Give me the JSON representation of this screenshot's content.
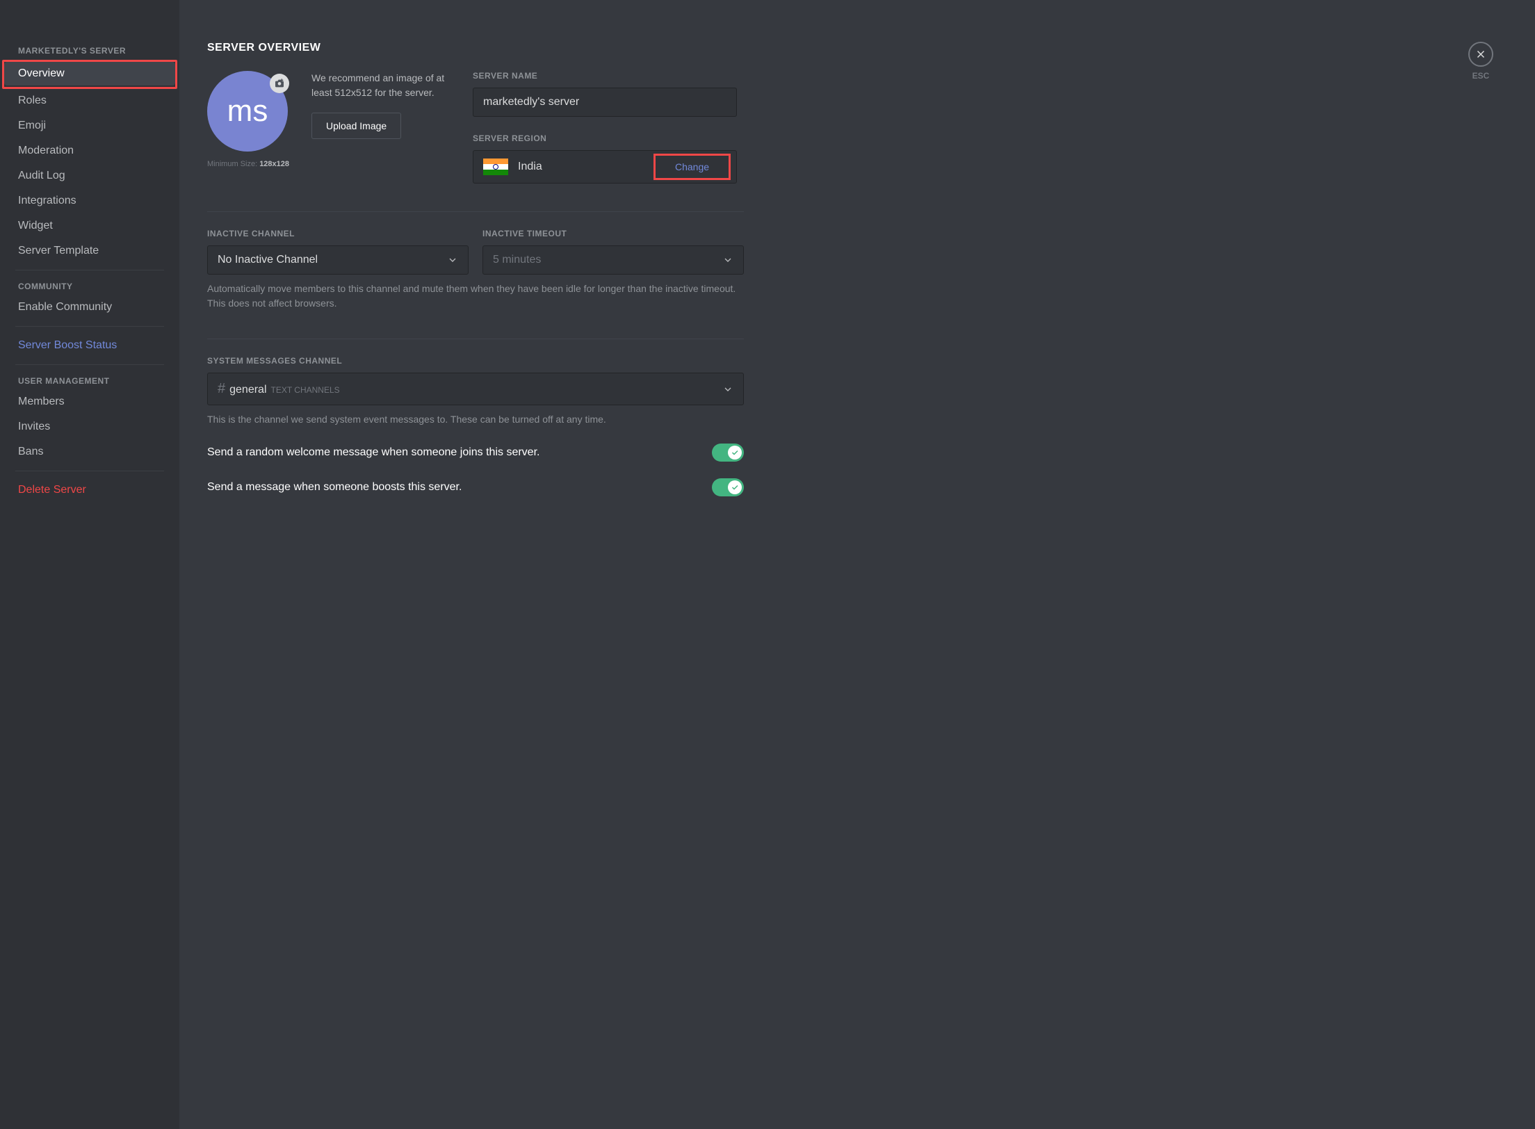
{
  "sidebar": {
    "section1_title": "MARKETEDLY'S SERVER",
    "items1": [
      "Overview",
      "Roles",
      "Emoji",
      "Moderation",
      "Audit Log",
      "Integrations",
      "Widget",
      "Server Template"
    ],
    "community_title": "COMMUNITY",
    "community_item": "Enable Community",
    "boost_item": "Server Boost Status",
    "user_mgmt_title": "USER MANAGEMENT",
    "user_mgmt_items": [
      "Members",
      "Invites",
      "Bans"
    ],
    "delete": "Delete Server"
  },
  "close": {
    "esc": "ESC"
  },
  "main": {
    "title": "SERVER OVERVIEW",
    "avatar_text": "ms",
    "min_size_prefix": "Minimum Size: ",
    "min_size_value": "128x128",
    "recommend": "We recommend an image of at least 512x512 for the server.",
    "upload_btn": "Upload Image",
    "server_name_label": "SERVER NAME",
    "server_name_value": "marketedly's server",
    "region_label": "SERVER REGION",
    "region_value": "India",
    "change_btn": "Change",
    "inactive_channel_label": "INACTIVE CHANNEL",
    "inactive_channel_value": "No Inactive Channel",
    "inactive_timeout_label": "INACTIVE TIMEOUT",
    "inactive_timeout_value": "5 minutes",
    "inactive_helper": "Automatically move members to this channel and mute them when they have been idle for longer than the inactive timeout. This does not affect browsers.",
    "system_channel_label": "SYSTEM MESSAGES CHANNEL",
    "system_channel_value": "general",
    "system_channel_cat": "TEXT CHANNELS",
    "system_helper": "This is the channel we send system event messages to. These can be turned off at any time.",
    "toggle1": "Send a random welcome message when someone joins this server.",
    "toggle2": "Send a message when someone boosts this server."
  }
}
